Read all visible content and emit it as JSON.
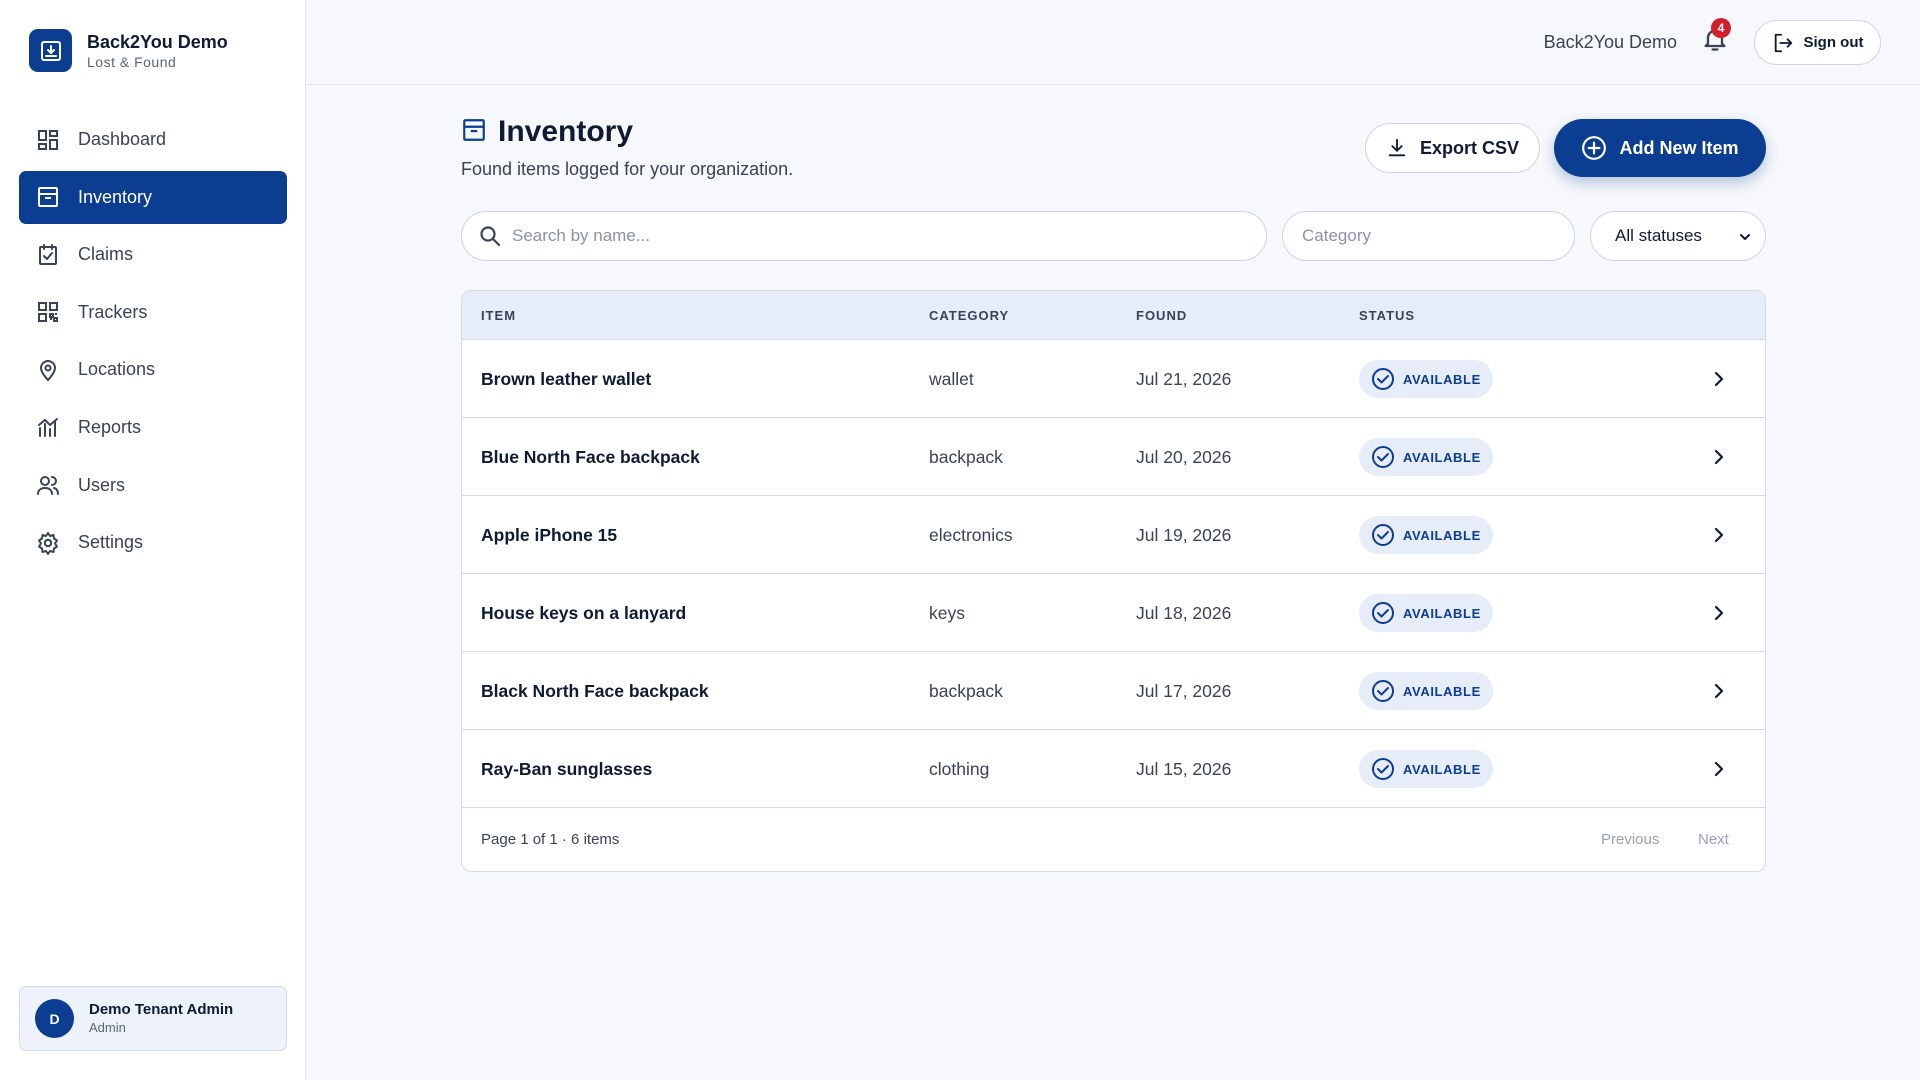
{
  "brand": {
    "name": "Back2You Demo",
    "subtitle": "Lost & Found",
    "logo_icon": "inbox-download-icon"
  },
  "sidebar": {
    "items": [
      {
        "label": "Dashboard",
        "icon": "dashboard-icon"
      },
      {
        "label": "Inventory",
        "icon": "archive-box-icon",
        "active": true
      },
      {
        "label": "Claims",
        "icon": "clipboard-check-icon"
      },
      {
        "label": "Trackers",
        "icon": "qr-code-icon"
      },
      {
        "label": "Locations",
        "icon": "map-pin-icon"
      },
      {
        "label": "Reports",
        "icon": "bar-chart-icon"
      },
      {
        "label": "Users",
        "icon": "users-icon"
      },
      {
        "label": "Settings",
        "icon": "gear-icon"
      }
    ]
  },
  "user": {
    "initial": "D",
    "name": "Demo Tenant Admin",
    "role": "Admin"
  },
  "topbar": {
    "tenant": "Back2You Demo",
    "notification_count": "4",
    "signout_label": "Sign out"
  },
  "page": {
    "title": "Inventory",
    "subtitle": "Found items logged for your organization.",
    "export_label": "Export CSV",
    "add_label": "Add New Item"
  },
  "filters": {
    "search_placeholder": "Search by name...",
    "category_placeholder": "Category",
    "status_value": "All statuses"
  },
  "table": {
    "headers": {
      "item": "ITEM",
      "category": "CATEGORY",
      "found": "FOUND",
      "status": "STATUS"
    },
    "rows": [
      {
        "item": "Brown leather wallet",
        "category": "wallet",
        "found": "Jul 21, 2026",
        "status": "AVAILABLE"
      },
      {
        "item": "Blue North Face backpack",
        "category": "backpack",
        "found": "Jul 20, 2026",
        "status": "AVAILABLE"
      },
      {
        "item": "Apple iPhone 15",
        "category": "electronics",
        "found": "Jul 19, 2026",
        "status": "AVAILABLE"
      },
      {
        "item": "House keys on a lanyard",
        "category": "keys",
        "found": "Jul 18, 2026",
        "status": "AVAILABLE"
      },
      {
        "item": "Black North Face backpack",
        "category": "backpack",
        "found": "Jul 17, 2026",
        "status": "AVAILABLE"
      },
      {
        "item": "Ray-Ban sunglasses",
        "category": "clothing",
        "found": "Jul 15, 2026",
        "status": "AVAILABLE"
      }
    ],
    "footer": {
      "page_info": "Page 1 of 1 · 6 items",
      "previous": "Previous",
      "next": "Next"
    }
  },
  "colors": {
    "primary": "#0b3d91",
    "badge_bg": "#e6ecf8",
    "danger": "#d0202c",
    "background": "#f7f8fb"
  }
}
